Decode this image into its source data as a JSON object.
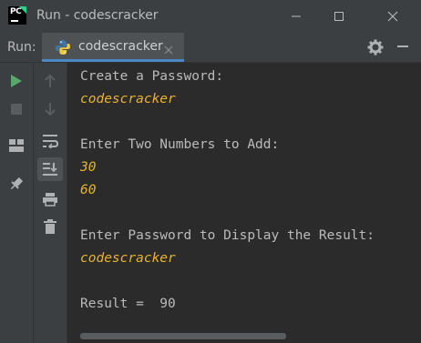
{
  "window": {
    "title": "Run - codescracker",
    "logo_text": "PC"
  },
  "toolwindow": {
    "label": "Run:",
    "tab_label": "codescracker"
  },
  "console": {
    "lines": [
      {
        "text": "Create a Password:",
        "kind": "output"
      },
      {
        "text": "codescracker",
        "kind": "input"
      },
      {
        "text": "",
        "kind": "blank"
      },
      {
        "text": "Enter Two Numbers to Add:",
        "kind": "output"
      },
      {
        "text": "30",
        "kind": "input"
      },
      {
        "text": "60",
        "kind": "input"
      },
      {
        "text": "",
        "kind": "blank"
      },
      {
        "text": "Enter Password to Display the Result:",
        "kind": "output"
      },
      {
        "text": "codescracker",
        "kind": "input"
      },
      {
        "text": "",
        "kind": "blank"
      },
      {
        "text": "Result =  90",
        "kind": "output"
      }
    ]
  },
  "colors": {
    "accent": "#4a88c7",
    "input_text": "#e8b32a",
    "output_text": "#bbbbbb",
    "run_green": "#59a869"
  },
  "icons": {
    "left_toolbar": [
      "run-icon",
      "stop-icon",
      "layout-icon",
      "pin-icon"
    ],
    "right_toolbar": [
      "up-arrow-icon",
      "down-arrow-icon",
      "soft-wrap-icon",
      "scroll-to-end-icon",
      "print-icon",
      "trash-icon"
    ]
  }
}
